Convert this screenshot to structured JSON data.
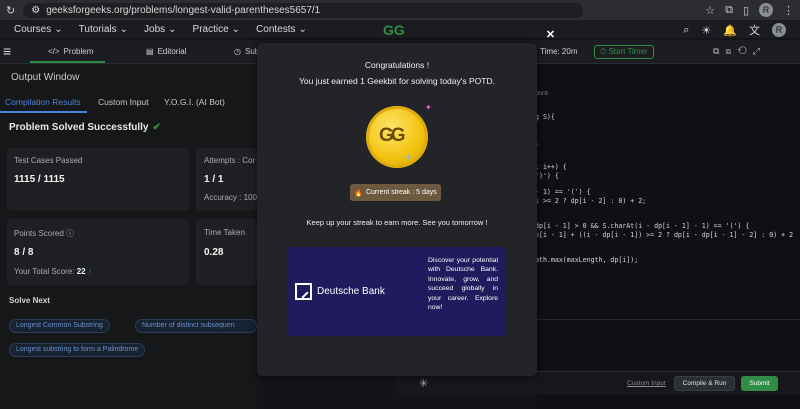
{
  "browser": {
    "url": "geeksforgeeks.org/problems/longest-valid-parentheses5657/1",
    "avatar_letter": "R"
  },
  "site_nav": {
    "items": [
      "Courses",
      "Tutorials",
      "Jobs",
      "Practice",
      "Contests"
    ],
    "avatar_letter": "R",
    "logo": "GG"
  },
  "problem_tabs": {
    "problem": "Problem",
    "editorial": "Editorial",
    "submissions": "Subn",
    "timer": "Start Timer",
    "duration": "Time: 20m"
  },
  "output": {
    "window_title": "Output Window",
    "tabs": [
      "Compilation Results",
      "Custom Input",
      "Y.O.G.I. (AI Bot)"
    ],
    "status": "Problem Solved Successfully",
    "test_cases_label": "Test Cases Passed",
    "test_cases_value": "1115 / 1115",
    "attempts_label": "Attempts : Cor",
    "attempts_value": "1 / 1",
    "accuracy_label": "Accuracy : 100",
    "points_label": "Points Scored",
    "points_value": "8 / 8",
    "total_score_label": "Your Total Score:",
    "total_score_value": "22",
    "time_label": "Time Taken",
    "time_value": "0.28",
    "solve_next_title": "Solve Next",
    "solve_next": [
      "Longest Common Substring",
      "Number of distinct subsequen",
      "Longest substring to form a Palindrome"
    ]
  },
  "modal": {
    "title": "Congratulations !",
    "message": "You just earned 1 Geekbit for solving today's POTD.",
    "streak": "Current streak : 5 days",
    "keep_up": "Keep up your streak to earn more. See you tomorrow !",
    "ad_brand": "Deutsche Bank",
    "ad_text": "Discover your potential with Deutsche Bank. Innovate, grow, and succeed globally in your career. Explore now!"
  },
  "editor": {
    "lines": [
      "ava",
      "g S){",
      ";",
      "; i++) {",
      "')') {",
      "- 1) == '(') {",
      "i >= 2 ? dp[i - 2] : 0) + 2;",
      "dp[i - 1] > 0 && S.charAt(i - dp[i - 1] - 1) == '(') {",
      "p[i - 1] + ((i - dp[i - 1]) >= 2 ? dp[i - dp[i - 1] - 2] : 0) + 2",
      "ath.max(maxLength, dp[i]);"
    ]
  },
  "bottom": {
    "custom_input": "Custom Input",
    "compile_run": "Compile & Run",
    "submit": "Submit"
  },
  "colors": {
    "accent_green": "#2f8d46",
    "coin_gold": "#f2c410",
    "ad_bg": "#1f1b5c"
  }
}
